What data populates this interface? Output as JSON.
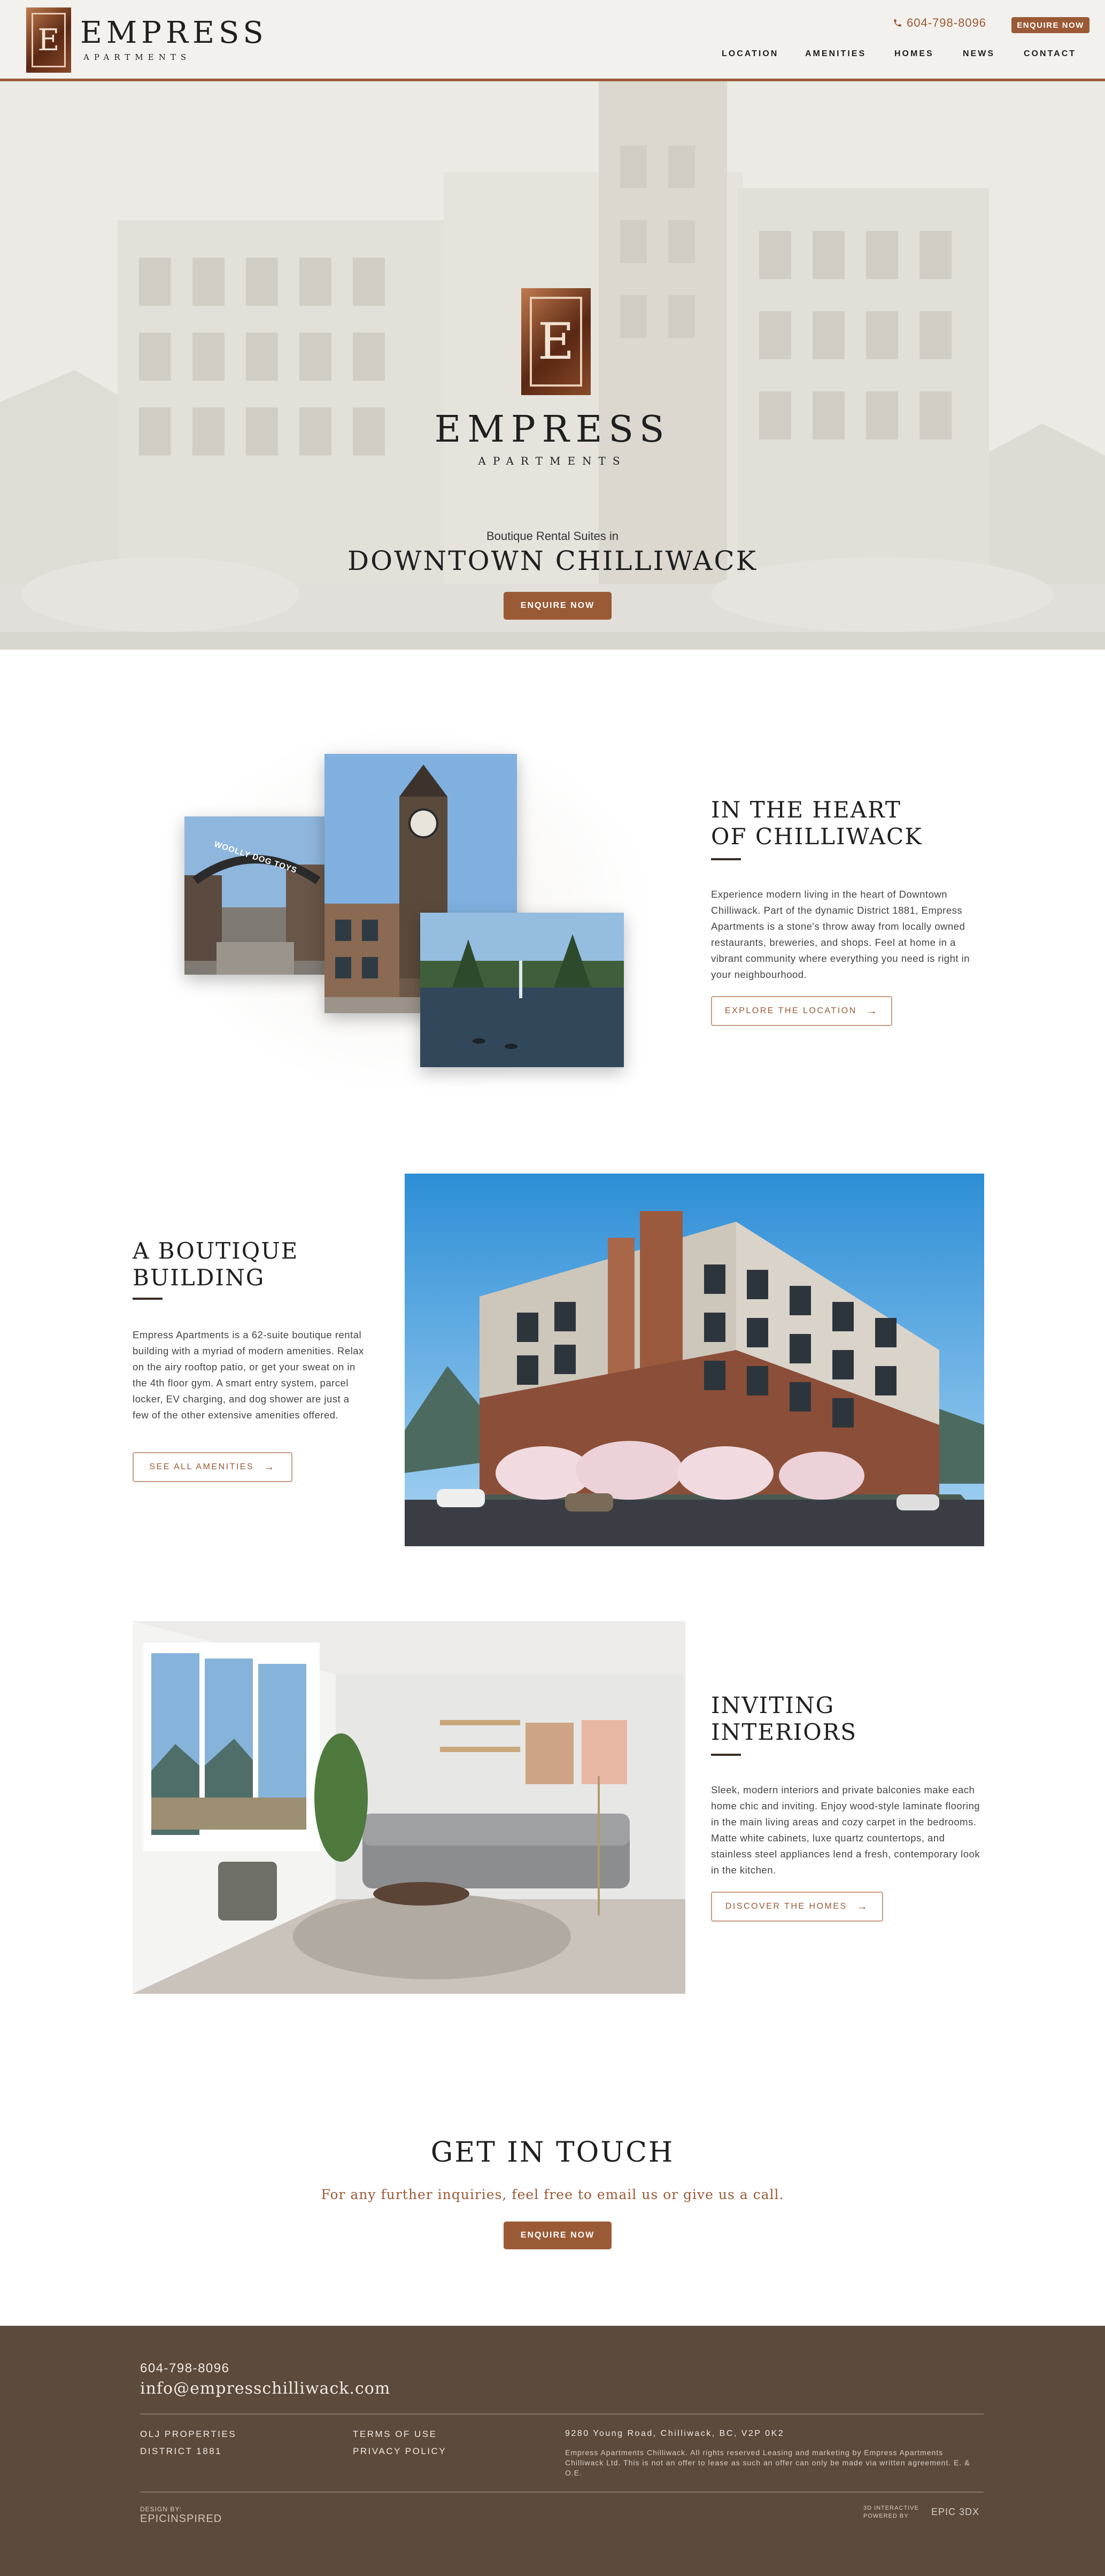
{
  "header": {
    "brand_name": "EMPRESS",
    "brand_sub": "APARTMENTS",
    "logo_letter": "E",
    "phone": "604-798-8096",
    "enquire": "ENQUIRE NOW",
    "nav": [
      "LOCATION",
      "AMENITIES",
      "HOMES",
      "NEWS",
      "CONTACT"
    ]
  },
  "hero": {
    "brand_name": "EMPRESS",
    "brand_sub": "APARTMENTS",
    "tagline": "Boutique Rental Suites in",
    "title": "DOWNTOWN CHILLIWACK",
    "button": "ENQUIRE NOW"
  },
  "location": {
    "title_line1": "IN THE HEART",
    "title_line2": "OF CHILLIWACK",
    "body": "Experience modern living in the heart of Downtown Chilliwack. Part of the dynamic District 1881, Empress Apartments is a stone's throw away from locally owned restaurants, breweries, and shops. Feel at home in a vibrant community where everything you need is right in your neighbourhood.",
    "button": "EXPLORE THE LOCATION",
    "sign_text": "WOOLLY DOG TOYS"
  },
  "building": {
    "title_line1": "A BOUTIQUE",
    "title_line2": "BUILDING",
    "body": "Empress Apartments is a 62-suite boutique rental building with a myriad of modern amenities. Relax on the airy rooftop patio, or get your sweat on in the 4th floor gym. A smart entry system, parcel locker, EV charging, and dog shower are just a few of the other extensive amenities offered.",
    "button": "SEE ALL AMENITIES"
  },
  "interiors": {
    "title_line1": "INVITING",
    "title_line2": "INTERIORS",
    "body": "Sleek, modern interiors and private balconies make each home chic and inviting. Enjoy wood-style laminate flooring in the main living areas and cozy carpet in the bedrooms. Matte white cabinets, luxe quartz countertops, and stainless steel appliances lend a fresh, contemporary look in the kitchen.",
    "button": "DISCOVER THE HOMES"
  },
  "contact": {
    "title": "GET IN TOUCH",
    "subtitle": "For any further inquiries, feel free to email us or give us a call.",
    "button": "ENQUIRE NOW"
  },
  "footer": {
    "phone": "604-798-8096",
    "email": "info@empresschilliwack.com",
    "col1": [
      "OLJ PROPERTIES",
      "DISTRICT 1881"
    ],
    "col2": [
      "TERMS OF USE",
      "PRIVACY POLICY"
    ],
    "address": "9280 Young Road, Chilliwack, BC, V2P 0K2",
    "legal": "Empress Apartments Chilliwack. All rights reserved Leasing and marketing by Empress Apartments Chilliwack Ltd. This is not an offer to lease as such an offer can only be made via written agreement. E. & O.E.",
    "design_by": "DESIGN BY:",
    "designer": "EPICINSPIRED",
    "powered_label": "3D INTERACTIVE POWERED BY",
    "powered_brand": "EPIC 3DX"
  },
  "colors": {
    "accent": "#9a5a36",
    "footer_bg": "#5c4a3d",
    "header_bg": "#f3f1ed"
  }
}
